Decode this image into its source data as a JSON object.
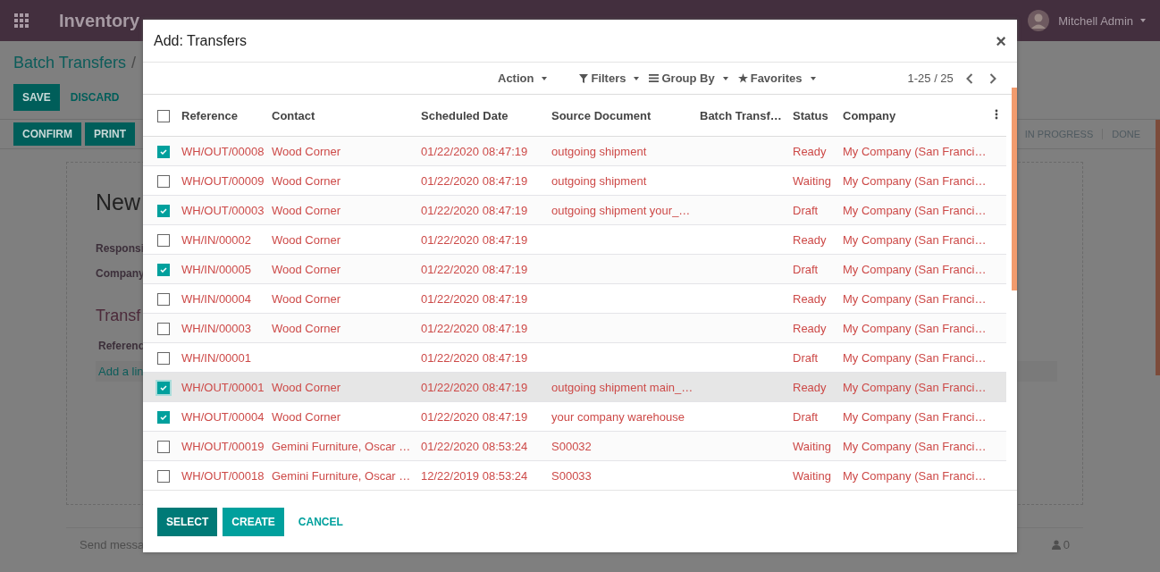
{
  "navbar": {
    "app_name": "Inventory",
    "user": "Mitchell Admin"
  },
  "breadcrumb": {
    "parent": "Batch Transfers",
    "separator": "/"
  },
  "form_buttons": [
    {
      "label": "SAVE",
      "kind": "primary"
    },
    {
      "label": "DISCARD",
      "kind": "link"
    }
  ],
  "action_buttons": [
    "CONFIRM",
    "PRINT"
  ],
  "stages": [
    "IN PROGRESS",
    "DONE"
  ],
  "sheet": {
    "title": "New",
    "fields": [
      "Responsi",
      "Company"
    ],
    "section": "Transf",
    "column": "Referenc",
    "add_line": "Add a lin"
  },
  "chatter": {
    "send_message": "Send messa",
    "followers": "0"
  },
  "dialog": {
    "title": "Add: Transfers",
    "close": "×",
    "toolbar": {
      "action": "Action",
      "filters": "Filters",
      "group_by": "Group By",
      "favorites": "Favorites",
      "pager": "1-25 / 25"
    },
    "all_checked": false,
    "columns": [
      "Reference",
      "Contact",
      "Scheduled Date",
      "Source Document",
      "Batch Transf…",
      "Status",
      "Company"
    ],
    "rows": [
      {
        "checked": true,
        "focused": false,
        "cells": [
          "WH/OUT/00008",
          "Wood Corner",
          "01/22/2020 08:47:19",
          "outgoing shipment",
          "",
          "Ready",
          "My Company (San Franci…"
        ]
      },
      {
        "checked": false,
        "focused": false,
        "cells": [
          "WH/OUT/00009",
          "Wood Corner",
          "01/22/2020 08:47:19",
          "outgoing shipment",
          "",
          "Waiting",
          "My Company (San Franci…"
        ]
      },
      {
        "checked": true,
        "focused": false,
        "cells": [
          "WH/OUT/00003",
          "Wood Corner",
          "01/22/2020 08:47:19",
          "outgoing shipment your_…",
          "",
          "Draft",
          "My Company (San Franci…"
        ]
      },
      {
        "checked": false,
        "focused": false,
        "cells": [
          "WH/IN/00002",
          "Wood Corner",
          "01/22/2020 08:47:19",
          "",
          "",
          "Ready",
          "My Company (San Franci…"
        ]
      },
      {
        "checked": true,
        "focused": false,
        "cells": [
          "WH/IN/00005",
          "Wood Corner",
          "01/22/2020 08:47:19",
          "",
          "",
          "Draft",
          "My Company (San Franci…"
        ]
      },
      {
        "checked": false,
        "focused": false,
        "cells": [
          "WH/IN/00004",
          "Wood Corner",
          "01/22/2020 08:47:19",
          "",
          "",
          "Ready",
          "My Company (San Franci…"
        ]
      },
      {
        "checked": false,
        "focused": false,
        "cells": [
          "WH/IN/00003",
          "Wood Corner",
          "01/22/2020 08:47:19",
          "",
          "",
          "Ready",
          "My Company (San Franci…"
        ]
      },
      {
        "checked": false,
        "focused": false,
        "cells": [
          "WH/IN/00001",
          "",
          "01/22/2020 08:47:19",
          "",
          "",
          "Draft",
          "My Company (San Franci…"
        ]
      },
      {
        "checked": true,
        "focused": true,
        "cells": [
          "WH/OUT/00001",
          "Wood Corner",
          "01/22/2020 08:47:19",
          "outgoing shipment main_…",
          "",
          "Ready",
          "My Company (San Franci…"
        ]
      },
      {
        "checked": true,
        "focused": false,
        "cells": [
          "WH/OUT/00004",
          "Wood Corner",
          "01/22/2020 08:47:19",
          "your company warehouse",
          "",
          "Draft",
          "My Company (San Franci…"
        ]
      },
      {
        "checked": false,
        "focused": false,
        "cells": [
          "WH/OUT/00019",
          "Gemini Furniture, Oscar …",
          "01/22/2020 08:53:24",
          "S00032",
          "",
          "Waiting",
          "My Company (San Franci…"
        ]
      },
      {
        "checked": false,
        "focused": false,
        "cells": [
          "WH/OUT/00018",
          "Gemini Furniture, Oscar …",
          "12/22/2019 08:53:24",
          "S00033",
          "",
          "Waiting",
          "My Company (San Franci…"
        ]
      }
    ],
    "buttons": [
      {
        "label": "SELECT",
        "kind": "primary"
      },
      {
        "label": "CREATE",
        "kind": "secondary"
      },
      {
        "label": "CANCEL",
        "kind": "link"
      }
    ]
  }
}
